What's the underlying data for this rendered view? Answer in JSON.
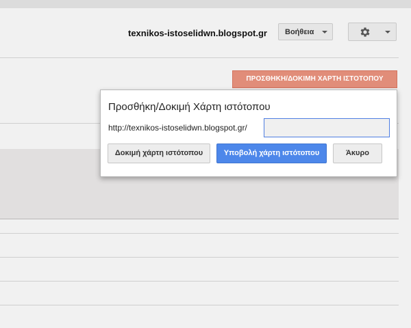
{
  "header": {
    "site": "texnikos-istoselidwn.blogspot.gr",
    "help_label": "Βοήθεια",
    "settings_icon": "gear-icon"
  },
  "toolbar": {
    "add_sitemap_label": "ΠΡΟΣΘΗΚΗ/ΔΟΚΙΜΗ ΧΑΡΤΗ ΙΣΤΟΤΟΠΟΥ"
  },
  "dialog": {
    "title": "Προσθήκη/Δοκιμή Χάρτη ιστότοπου",
    "url_prefix": "http://texnikos-istoselidwn.blogspot.gr/",
    "path_value": "",
    "test_label": "Δοκιμή χάρτη ιστότοπου",
    "submit_label": "Υποβολή χάρτη ιστότοπου",
    "cancel_label": "Άκυρο"
  },
  "colors": {
    "accent_red": "#e18d79",
    "primary_blue": "#4d87ea"
  }
}
